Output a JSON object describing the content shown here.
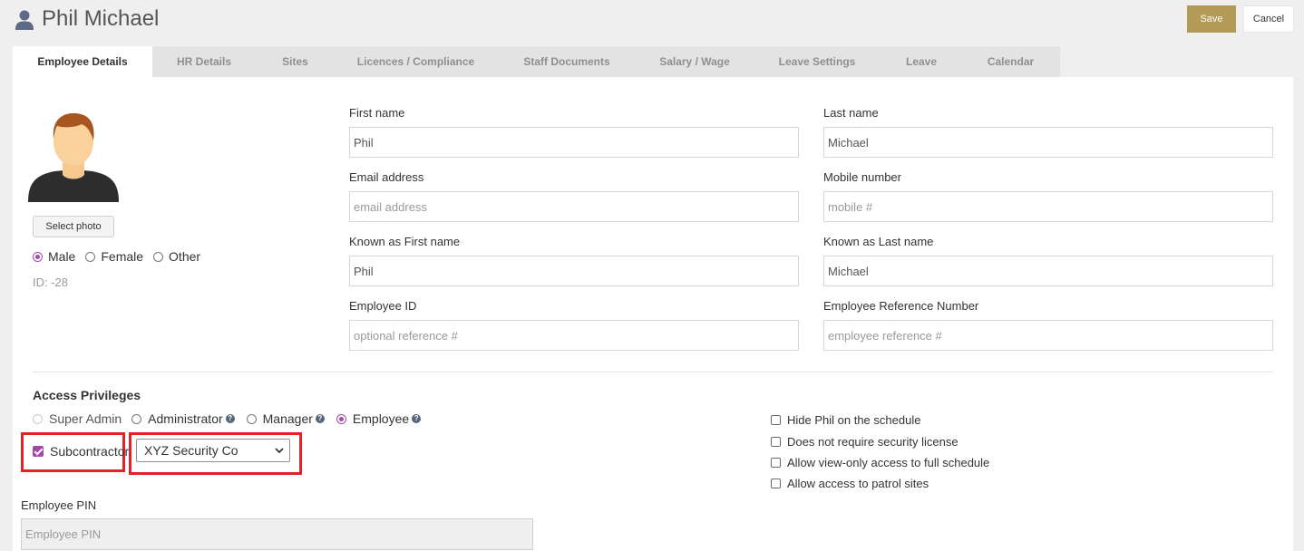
{
  "header": {
    "title": "Phil Michael",
    "save_label": "Save",
    "cancel_label": "Cancel"
  },
  "tabs": [
    {
      "label": "Employee Details",
      "active": true
    },
    {
      "label": "HR Details"
    },
    {
      "label": "Sites"
    },
    {
      "label": "Licences / Compliance"
    },
    {
      "label": "Staff Documents"
    },
    {
      "label": "Salary / Wage"
    },
    {
      "label": "Leave Settings"
    },
    {
      "label": "Leave"
    },
    {
      "label": "Calendar"
    }
  ],
  "profile": {
    "select_photo_label": "Select photo",
    "gender": {
      "male": "Male",
      "female": "Female",
      "other": "Other",
      "selected": "Male"
    },
    "id_text": "ID: -28"
  },
  "fields": {
    "first_name": {
      "label": "First name",
      "value": "Phil",
      "placeholder": ""
    },
    "last_name": {
      "label": "Last name",
      "value": "Michael",
      "placeholder": ""
    },
    "email": {
      "label": "Email address",
      "value": "",
      "placeholder": "email address"
    },
    "mobile": {
      "label": "Mobile number",
      "value": "",
      "placeholder": "mobile #"
    },
    "known_first": {
      "label": "Known as First name",
      "value": "Phil",
      "placeholder": ""
    },
    "known_last": {
      "label": "Known as Last name",
      "value": "Michael",
      "placeholder": ""
    },
    "employee_id": {
      "label": "Employee ID",
      "value": "",
      "placeholder": "optional reference #"
    },
    "employee_ref": {
      "label": "Employee Reference Number",
      "value": "",
      "placeholder": "employee reference #"
    }
  },
  "access": {
    "title": "Access Privileges",
    "roles": {
      "super_admin": "Super Admin",
      "administrator": "Administrator",
      "manager": "Manager",
      "employee": "Employee",
      "selected": "Employee"
    },
    "subcontractor_label": "Subcontractor",
    "subcontractor_checked": true,
    "company_selected": "XYZ Security Co"
  },
  "options": [
    {
      "label": "Hide Phil on the schedule",
      "checked": false
    },
    {
      "label": "Does not require security license",
      "checked": false
    },
    {
      "label": "Allow view-only access to full schedule",
      "checked": false
    },
    {
      "label": "Allow access to patrol sites",
      "checked": false
    }
  ],
  "pin": {
    "label": "Employee PIN",
    "placeholder": "Employee PIN"
  },
  "colors": {
    "accent": "#b39a56",
    "radio": "#a34aa7",
    "highlight": "#e32227"
  }
}
